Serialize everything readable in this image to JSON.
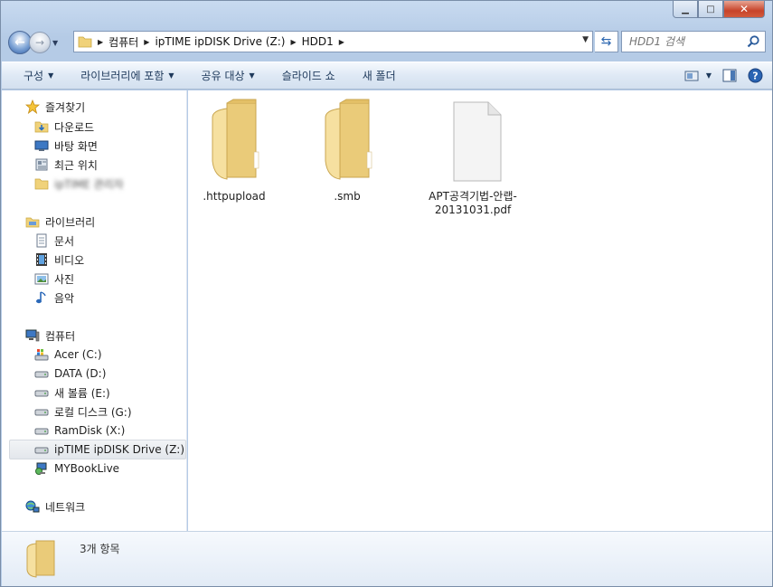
{
  "window": {
    "caption": {
      "minimize": "▁",
      "maximize": "□",
      "close": "✕"
    }
  },
  "address": {
    "crumbs": [
      "컴퓨터",
      "ipTIME ipDISK Drive (Z:)",
      "HDD1"
    ],
    "search_placeholder": "HDD1 검색"
  },
  "toolbar": {
    "organize": "구성",
    "include_library": "라이브러리에 포함",
    "share": "공유 대상",
    "slideshow": "슬라이드 쇼",
    "new_folder": "새 폴더"
  },
  "nav": {
    "favorites": {
      "header": "즐겨찾기",
      "items": [
        "다운로드",
        "바탕 화면",
        "최근 위치",
        "ipTIME 관리자"
      ]
    },
    "libraries": {
      "header": "라이브러리",
      "items": [
        "문서",
        "비디오",
        "사진",
        "음악"
      ]
    },
    "computer": {
      "header": "컴퓨터",
      "items": [
        "Acer (C:)",
        "DATA (D:)",
        "새 볼륨 (E:)",
        "로컬 디스크 (G:)",
        "RamDisk (X:)",
        "ipTIME ipDISK Drive (Z:)",
        "MYBookLive"
      ]
    },
    "network": {
      "header": "네트워크"
    }
  },
  "files": [
    {
      "name": ".httpupload",
      "type": "folder"
    },
    {
      "name": ".smb",
      "type": "folder"
    },
    {
      "name": "APT공격기법-안랩-20131031.pdf",
      "type": "file"
    }
  ],
  "details": {
    "count": "3개 항목"
  },
  "colors": {
    "window_frame": "#b5cbe6",
    "toolbar_text": "#1e395b",
    "folder": "#f2d98c",
    "close_button": "#c7432a"
  }
}
